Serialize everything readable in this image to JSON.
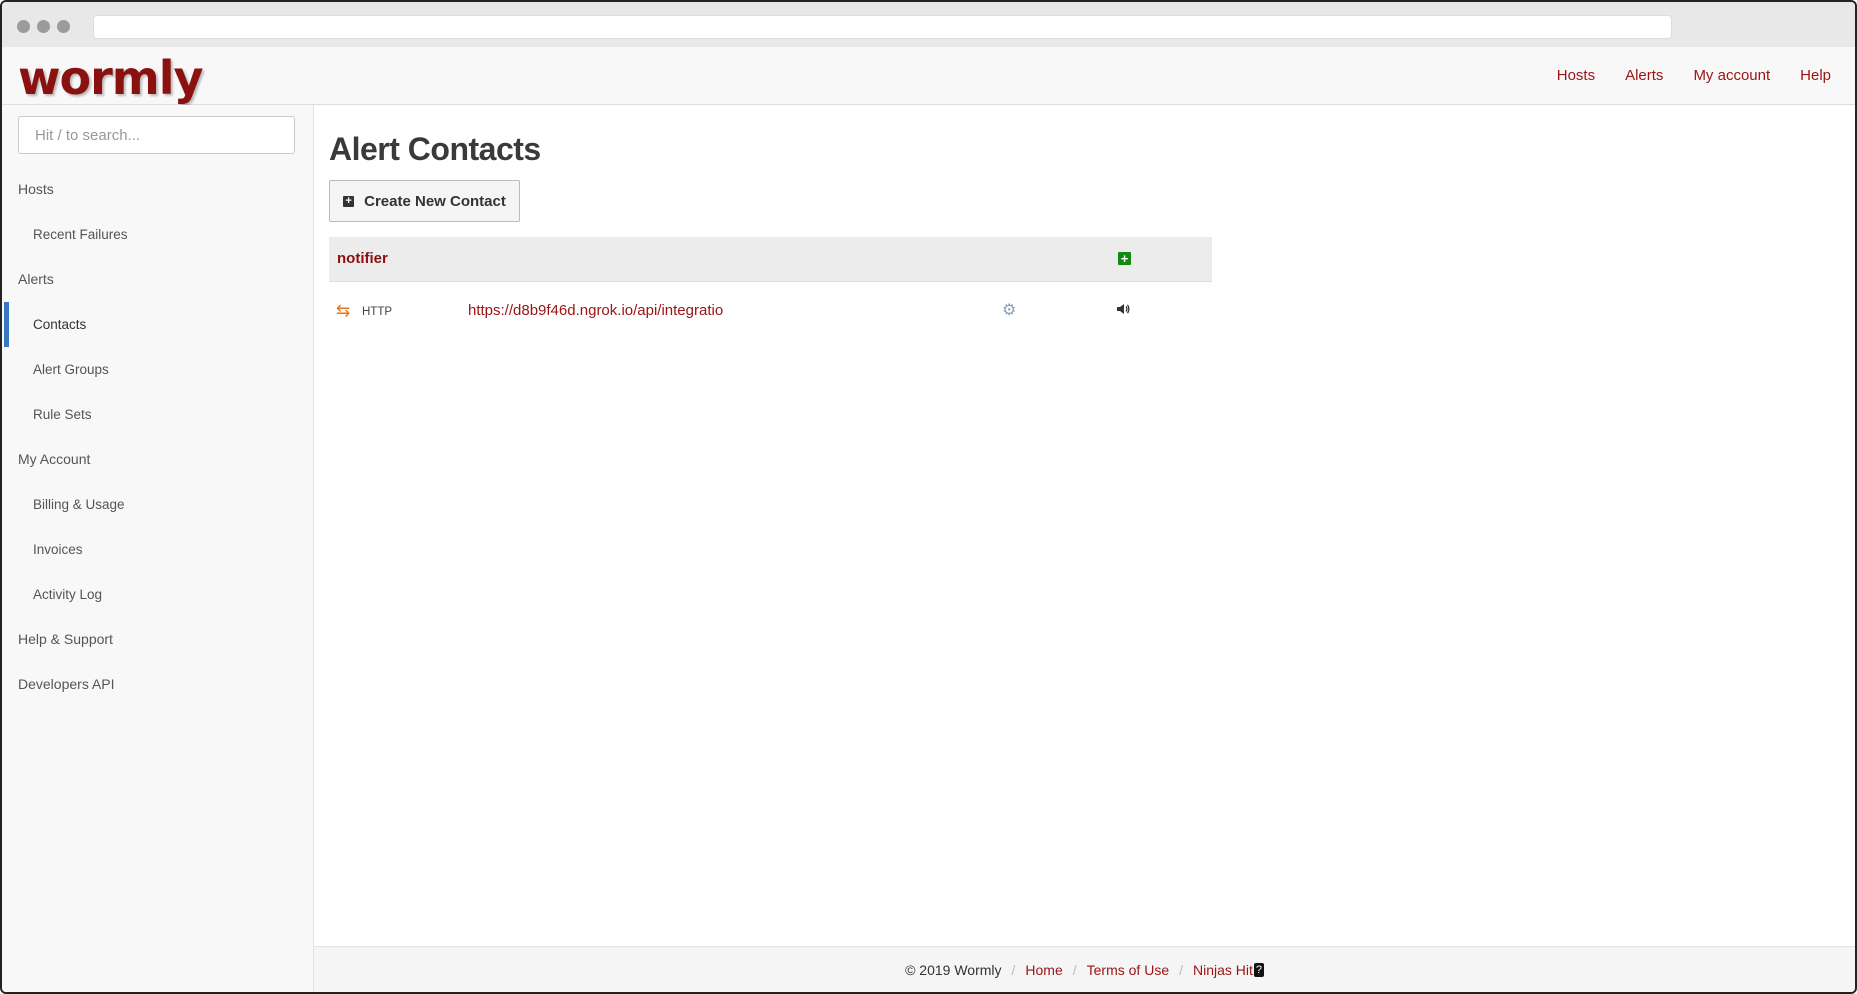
{
  "brand": {
    "logo_text": "wormly",
    "logo_color": "#8b1010"
  },
  "header": {
    "nav": [
      {
        "label": "Hosts"
      },
      {
        "label": "Alerts"
      },
      {
        "label": "My account"
      },
      {
        "label": "Help"
      }
    ]
  },
  "sidebar": {
    "search_placeholder": "Hit / to search...",
    "items": [
      {
        "label": "Hosts",
        "level": "top"
      },
      {
        "label": "Recent Failures",
        "level": "sub"
      },
      {
        "label": "Alerts",
        "level": "top"
      },
      {
        "label": "Contacts",
        "level": "sub",
        "active": true
      },
      {
        "label": "Alert Groups",
        "level": "sub"
      },
      {
        "label": "Rule Sets",
        "level": "sub"
      },
      {
        "label": "My Account",
        "level": "top"
      },
      {
        "label": "Billing & Usage",
        "level": "sub"
      },
      {
        "label": "Invoices",
        "level": "sub"
      },
      {
        "label": "Activity Log",
        "level": "sub"
      },
      {
        "label": "Help & Support",
        "level": "top"
      },
      {
        "label": "Developers API",
        "level": "top"
      }
    ]
  },
  "main": {
    "title": "Alert Contacts",
    "create_button_label": "Create New Contact",
    "group": {
      "name": "notifier",
      "contacts": [
        {
          "type": "HTTP",
          "url": "https://d8b9f46d.ngrok.io/api/integratio"
        }
      ]
    }
  },
  "footer": {
    "copyright": "© 2019 Wormly",
    "links": [
      "Home",
      "Terms of Use",
      "Ninjas Hit"
    ],
    "qmark": "?"
  },
  "colors": {
    "link": "#9c1313",
    "active_bar": "#3a78c3",
    "add_green": "#128a12",
    "http_icon": "#e8761a"
  }
}
